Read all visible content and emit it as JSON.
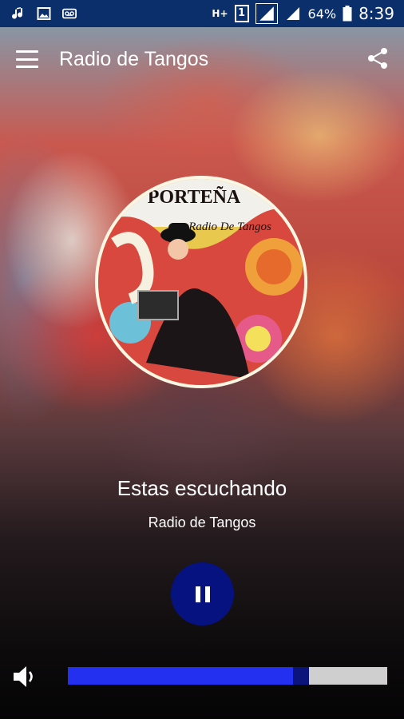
{
  "status_bar": {
    "battery": "64%",
    "time": "8:39",
    "sim_label": "1",
    "network_type": "H+"
  },
  "app_bar": {
    "title": "Radio de Tangos",
    "menu_icon": "hamburger-icon",
    "share_icon": "share-icon"
  },
  "album_art": {
    "brand_text": "PORTEÑA",
    "subtitle_text": "Radio De Tangos"
  },
  "now_playing": {
    "heading": "Estas escuchando",
    "station": "Radio de Tangos"
  },
  "controls": {
    "play_state": "pause-icon",
    "volume_icon": "speaker-icon",
    "volume_level": 0.73
  },
  "colors": {
    "status_bar": "#0b2f6b",
    "play_button": "#06127f",
    "volume_fill": "#2330f0",
    "volume_thumb": "#0a147a",
    "volume_track": "#cfcfcf"
  }
}
